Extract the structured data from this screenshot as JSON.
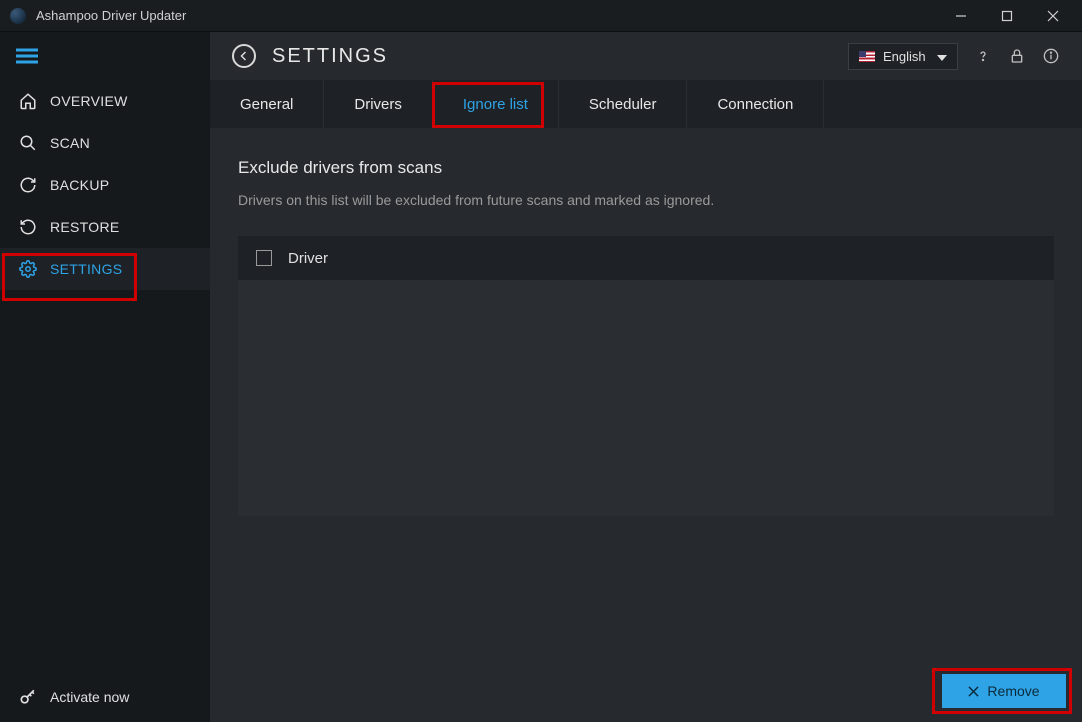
{
  "titlebar": {
    "title": "Ashampoo Driver Updater"
  },
  "sidebar": {
    "items": [
      {
        "label": "OVERVIEW"
      },
      {
        "label": "SCAN"
      },
      {
        "label": "BACKUP"
      },
      {
        "label": "RESTORE"
      },
      {
        "label": "SETTINGS"
      }
    ],
    "footer": "Activate now"
  },
  "header": {
    "page_title": "SETTINGS",
    "language": "English"
  },
  "tabs": [
    {
      "label": "General"
    },
    {
      "label": "Drivers"
    },
    {
      "label": "Ignore list"
    },
    {
      "label": "Scheduler"
    },
    {
      "label": "Connection"
    }
  ],
  "content": {
    "section_title": "Exclude drivers from scans",
    "section_desc": "Drivers on this list will be excluded from future scans and marked as ignored.",
    "column_header": "Driver"
  },
  "footer": {
    "remove_label": "Remove"
  }
}
